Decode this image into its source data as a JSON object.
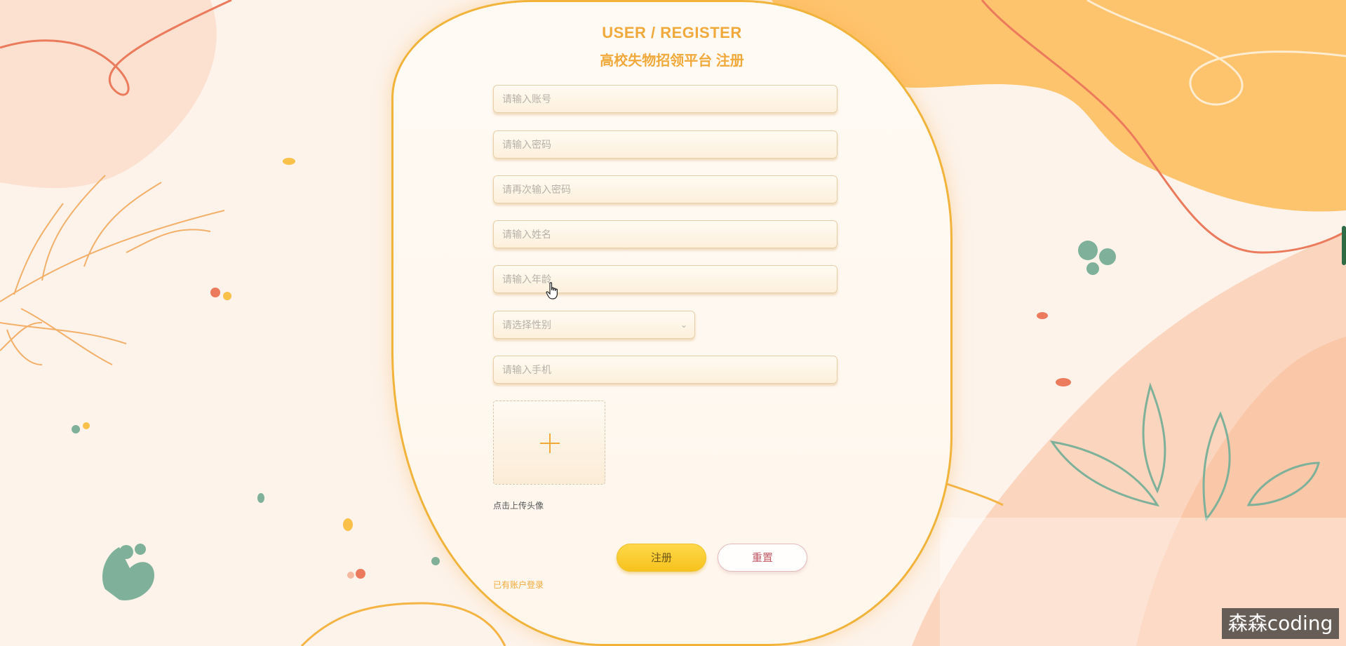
{
  "header": {
    "title_en": "USER / REGISTER",
    "title_cn": "高校失物招领平台 注册"
  },
  "form": {
    "account_placeholder": "请输入账号",
    "password_placeholder": "请输入密码",
    "confirm_password_placeholder": "请再次输入密码",
    "name_placeholder": "请输入姓名",
    "age_placeholder": "请输入年龄",
    "gender_placeholder": "请选择性别",
    "phone_placeholder": "请输入手机",
    "upload_label": "点击上传头像"
  },
  "actions": {
    "register_label": "注册",
    "reset_label": "重置",
    "login_link": "已有账户登录"
  },
  "icons": {
    "upload": "plus-icon",
    "select": "chevron-down-icon",
    "cursor": "hand-pointer-icon"
  },
  "colors": {
    "accent": "#f2a93b",
    "register_button": "#f6c21d",
    "reset_text": "#c25a66",
    "background": "#fdf3ea"
  },
  "watermark": "森森coding"
}
